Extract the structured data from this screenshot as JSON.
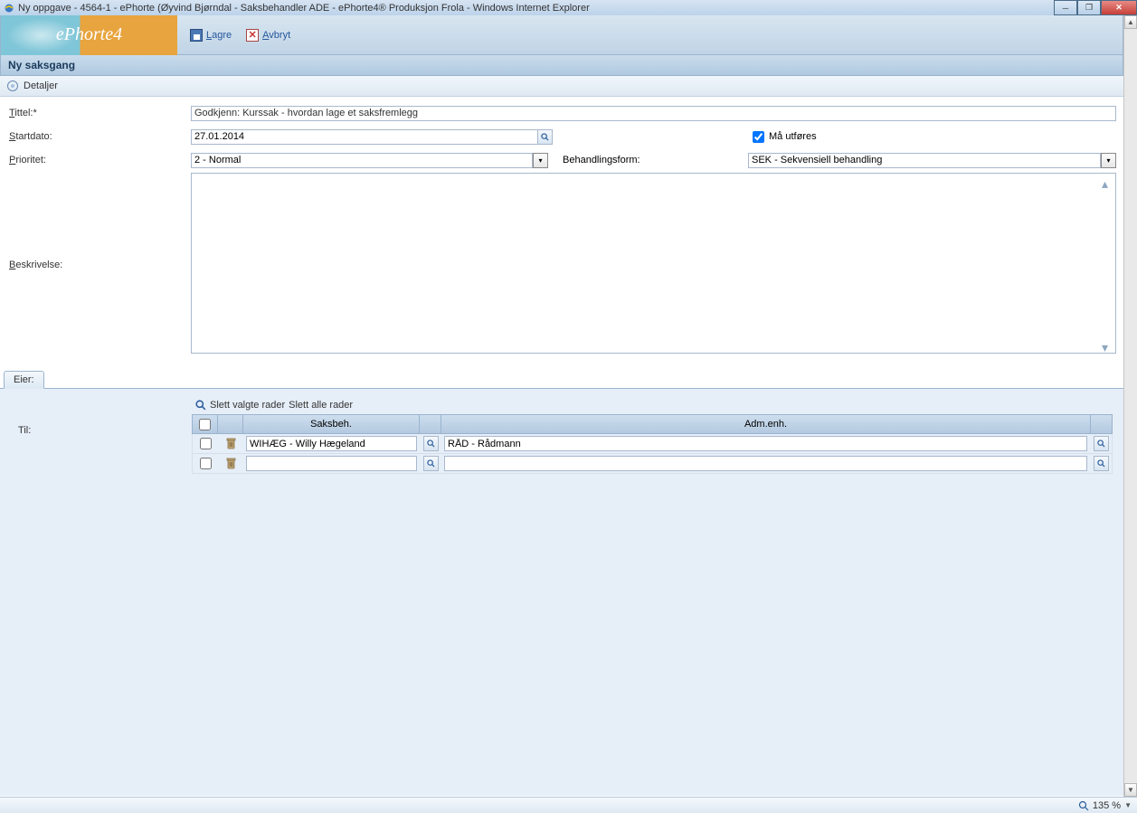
{
  "window": {
    "title": "Ny oppgave - 4564-1 - ePhorte (Øyvind Bjørndal - Saksbehandler ADE - ePhorte4® Produksjon Frola - Windows Internet Explorer"
  },
  "logo": {
    "text": "ePhorte4"
  },
  "toolbar": {
    "lagre": "Lagre",
    "avbryt": "Avbryt"
  },
  "section": {
    "title": "Ny saksgang",
    "detaljer": "Detaljer"
  },
  "form": {
    "tittel_label": "Tittel:*",
    "tittel_value": "Godkjenn: Kurssak - hvordan lage et saksfremlegg",
    "startdato_label": "Startdato:",
    "startdato_value": "27.01.2014",
    "maa_utfores": "Må utføres",
    "maa_utfores_checked": true,
    "prioritet_label": "Prioritet:",
    "prioritet_value": "2 - Normal",
    "behandlingsform_label": "Behandlingsform:",
    "behandlingsform_value": "SEK - Sekvensiell behandling",
    "beskrivelse_label": "Beskrivelse:",
    "beskrivelse_value": ""
  },
  "tabs": {
    "eier": "Eier:"
  },
  "lower": {
    "til_label": "Til:",
    "slett_valgte": "Slett valgte rader",
    "slett_alle": "Slett alle rader",
    "col_saksbeh": "Saksbeh.",
    "col_admenh": "Adm.enh.",
    "rows": [
      {
        "saksbeh": "WIHÆG - Willy Hægeland",
        "admenh": "RÅD - Rådmann"
      },
      {
        "saksbeh": "",
        "admenh": ""
      }
    ]
  },
  "statusbar": {
    "zoom": "135 %"
  }
}
